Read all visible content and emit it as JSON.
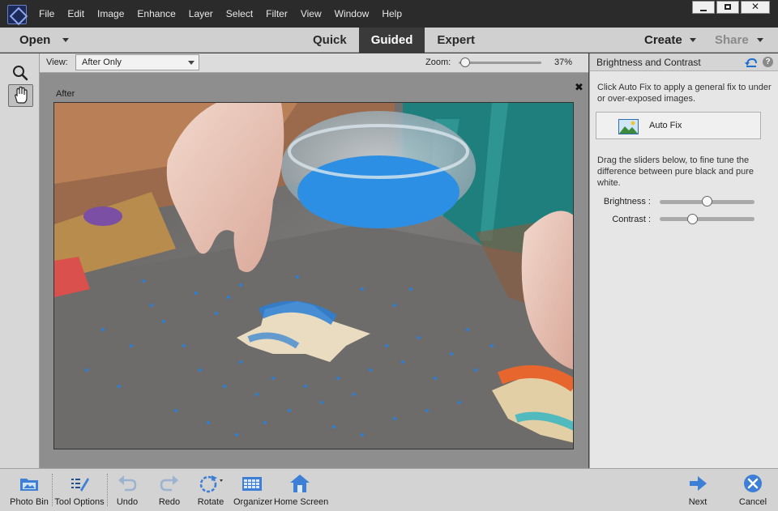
{
  "menu": [
    "File",
    "Edit",
    "Image",
    "Enhance",
    "Layer",
    "Select",
    "Filter",
    "View",
    "Window",
    "Help"
  ],
  "window_controls": {
    "minimize": "minimize",
    "maximize": "maximize",
    "close": "✕"
  },
  "modebar": {
    "open_label": "Open",
    "tabs": [
      {
        "label": "Quick",
        "active": false
      },
      {
        "label": "Guided",
        "active": true
      },
      {
        "label": "Expert",
        "active": false
      }
    ],
    "create_label": "Create",
    "share_label": "Share"
  },
  "options": {
    "view_label": "View:",
    "view_value": "After Only",
    "zoom_label": "Zoom:",
    "zoom_value": "37%",
    "zoom_fraction": 0.08
  },
  "canvas": {
    "after_label": "After",
    "close_glyph": "✖"
  },
  "panel": {
    "title": "Brightness and Contrast",
    "help_glyph": "?",
    "autofix_description": "Click Auto Fix to apply a general fix to under or over-exposed images.",
    "autofix_label": "Auto Fix",
    "slider_description": "Drag the sliders below, to fine tune the difference between pure black and pure white.",
    "brightness_label": "Brightness :",
    "contrast_label": "Contrast :",
    "brightness_fraction": 0.5,
    "contrast_fraction": 0.35
  },
  "bottombar": {
    "items": [
      "Photo Bin",
      "Tool Options",
      "Undo",
      "Redo",
      "Rotate",
      "Organizer",
      "Home Screen"
    ],
    "next_label": "Next",
    "cancel_label": "Cancel"
  },
  "colors": {
    "accent_blue": "#3d7fd6",
    "active_tab": "#3a3a3a",
    "titlebar": "#2b2b2b"
  }
}
